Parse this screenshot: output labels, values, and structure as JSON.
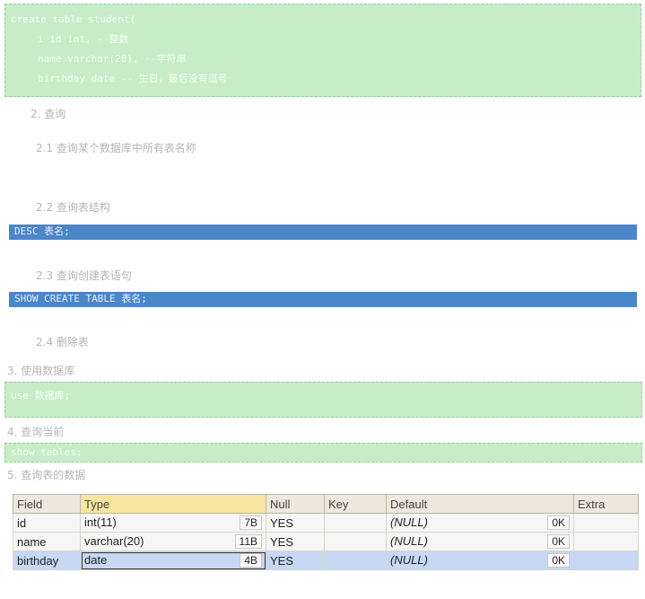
{
  "code_block_create": {
    "lines": [
      "create table student(",
      "  i id int, --整数",
      "  name varchar(20), --字符串",
      "  birthday date -- 生日，最后没有逗号"
    ]
  },
  "steps": {
    "s2": "2. 查询",
    "s2_1": "2.1   查询某个数据库中所有表名称",
    "s2_2": "2.2   查询表结构",
    "s2_3": "2.3   查询创建表语句",
    "s2_4": "2.4   删除表",
    "s3": "3.    使用数据库",
    "s4": "4.    查询当前",
    "s5": "5.    查询表的数据"
  },
  "code_desc": "DESC 表名;",
  "code_show_create": "SHOW CREATE TABLE 表名;",
  "code_use": "use 数据库;",
  "code_show_tables": "show tables;",
  "result_table": {
    "headers": [
      "Field",
      "Type",
      "Null",
      "Key",
      "Default",
      "Extra"
    ],
    "rows": [
      {
        "field": "id",
        "type": "int(11)",
        "size": "7B",
        "null": "YES",
        "key": "",
        "default": "(NULL)",
        "dsize": "0K",
        "extra": ""
      },
      {
        "field": "name",
        "type": "varchar(20)",
        "size": "11B",
        "null": "YES",
        "key": "",
        "default": "(NULL)",
        "dsize": "0K",
        "extra": ""
      },
      {
        "field": "birthday",
        "type": "date",
        "size": "4B",
        "null": "YES",
        "key": "",
        "default": "(NULL)",
        "dsize": "0K",
        "extra": ""
      }
    ]
  }
}
